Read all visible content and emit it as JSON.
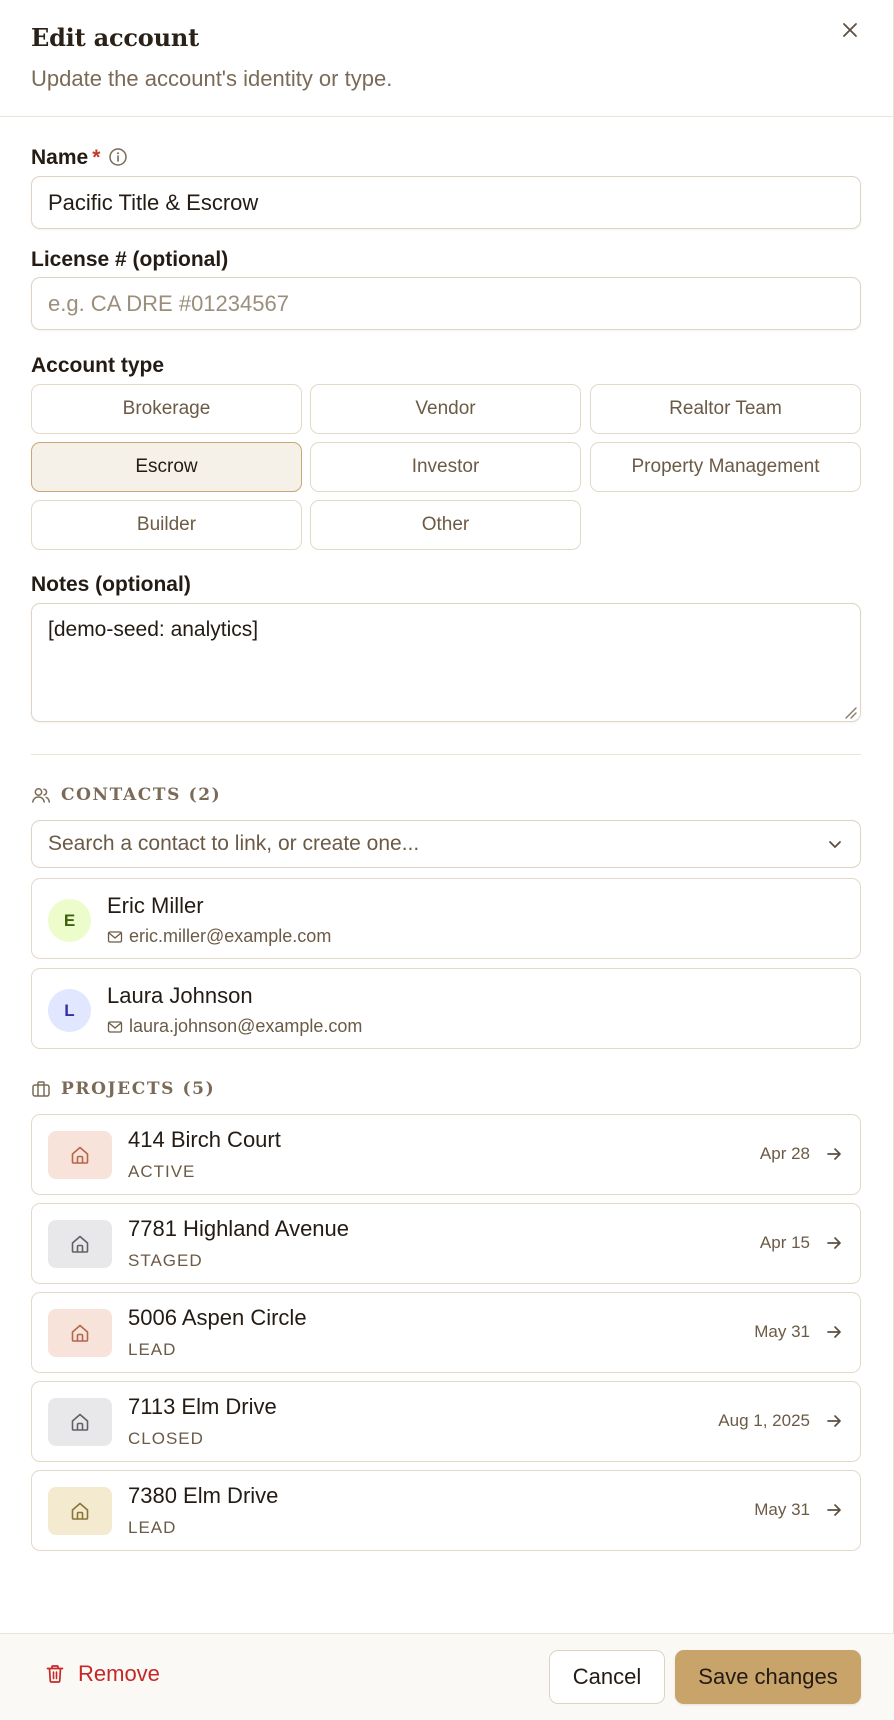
{
  "header": {
    "title": "Edit account",
    "subtitle": "Update the account's identity or type."
  },
  "form": {
    "name_label": "Name",
    "required_mark": "*",
    "name_value": "Pacific Title & Escrow",
    "license_label": "License # (optional)",
    "license_placeholder": "e.g. CA DRE #01234567",
    "license_value": "",
    "type_label": "Account type",
    "types": [
      {
        "label": "Brokerage",
        "selected": false
      },
      {
        "label": "Vendor",
        "selected": false
      },
      {
        "label": "Realtor Team",
        "selected": false
      },
      {
        "label": "Escrow",
        "selected": true
      },
      {
        "label": "Investor",
        "selected": false
      },
      {
        "label": "Property Management",
        "selected": false
      },
      {
        "label": "Builder",
        "selected": false
      },
      {
        "label": "Other",
        "selected": false
      }
    ],
    "notes_label": "Notes (optional)",
    "notes_value": "[demo-seed: analytics]"
  },
  "contacts": {
    "heading": "CONTACTS (2)",
    "search_placeholder": "Search a contact to link, or create one...",
    "items": [
      {
        "initial": "E",
        "name": "Eric Miller",
        "email": "eric.miller@example.com",
        "avatar_bg": "#ecfccb",
        "avatar_fg": "#3f6212"
      },
      {
        "initial": "L",
        "name": "Laura Johnson",
        "email": "laura.johnson@example.com",
        "avatar_bg": "#e0e7ff",
        "avatar_fg": "#3730a3"
      }
    ]
  },
  "projects": {
    "heading": "PROJECTS (5)",
    "items": [
      {
        "name": "414 Birch Court",
        "status": "ACTIVE",
        "date": "Apr 28",
        "icon_bg": "#f8e3da",
        "icon_fg": "#b5654a"
      },
      {
        "name": "7781 Highland Avenue",
        "status": "STAGED",
        "date": "Apr 15",
        "icon_bg": "#e8e8ea",
        "icon_fg": "#5f6068"
      },
      {
        "name": "5006 Aspen Circle",
        "status": "LEAD",
        "date": "May 31",
        "icon_bg": "#f8e3da",
        "icon_fg": "#b5654a"
      },
      {
        "name": "7113 Elm Drive",
        "status": "CLOSED",
        "date": "Aug 1, 2025",
        "icon_bg": "#e8e8ea",
        "icon_fg": "#5f6068"
      },
      {
        "name": "7380 Elm Drive",
        "status": "LEAD",
        "date": "May 31",
        "icon_bg": "#f3ead0",
        "icon_fg": "#8a7435"
      }
    ]
  },
  "footer": {
    "remove_label": "Remove",
    "cancel_label": "Cancel",
    "save_label": "Save changes"
  }
}
